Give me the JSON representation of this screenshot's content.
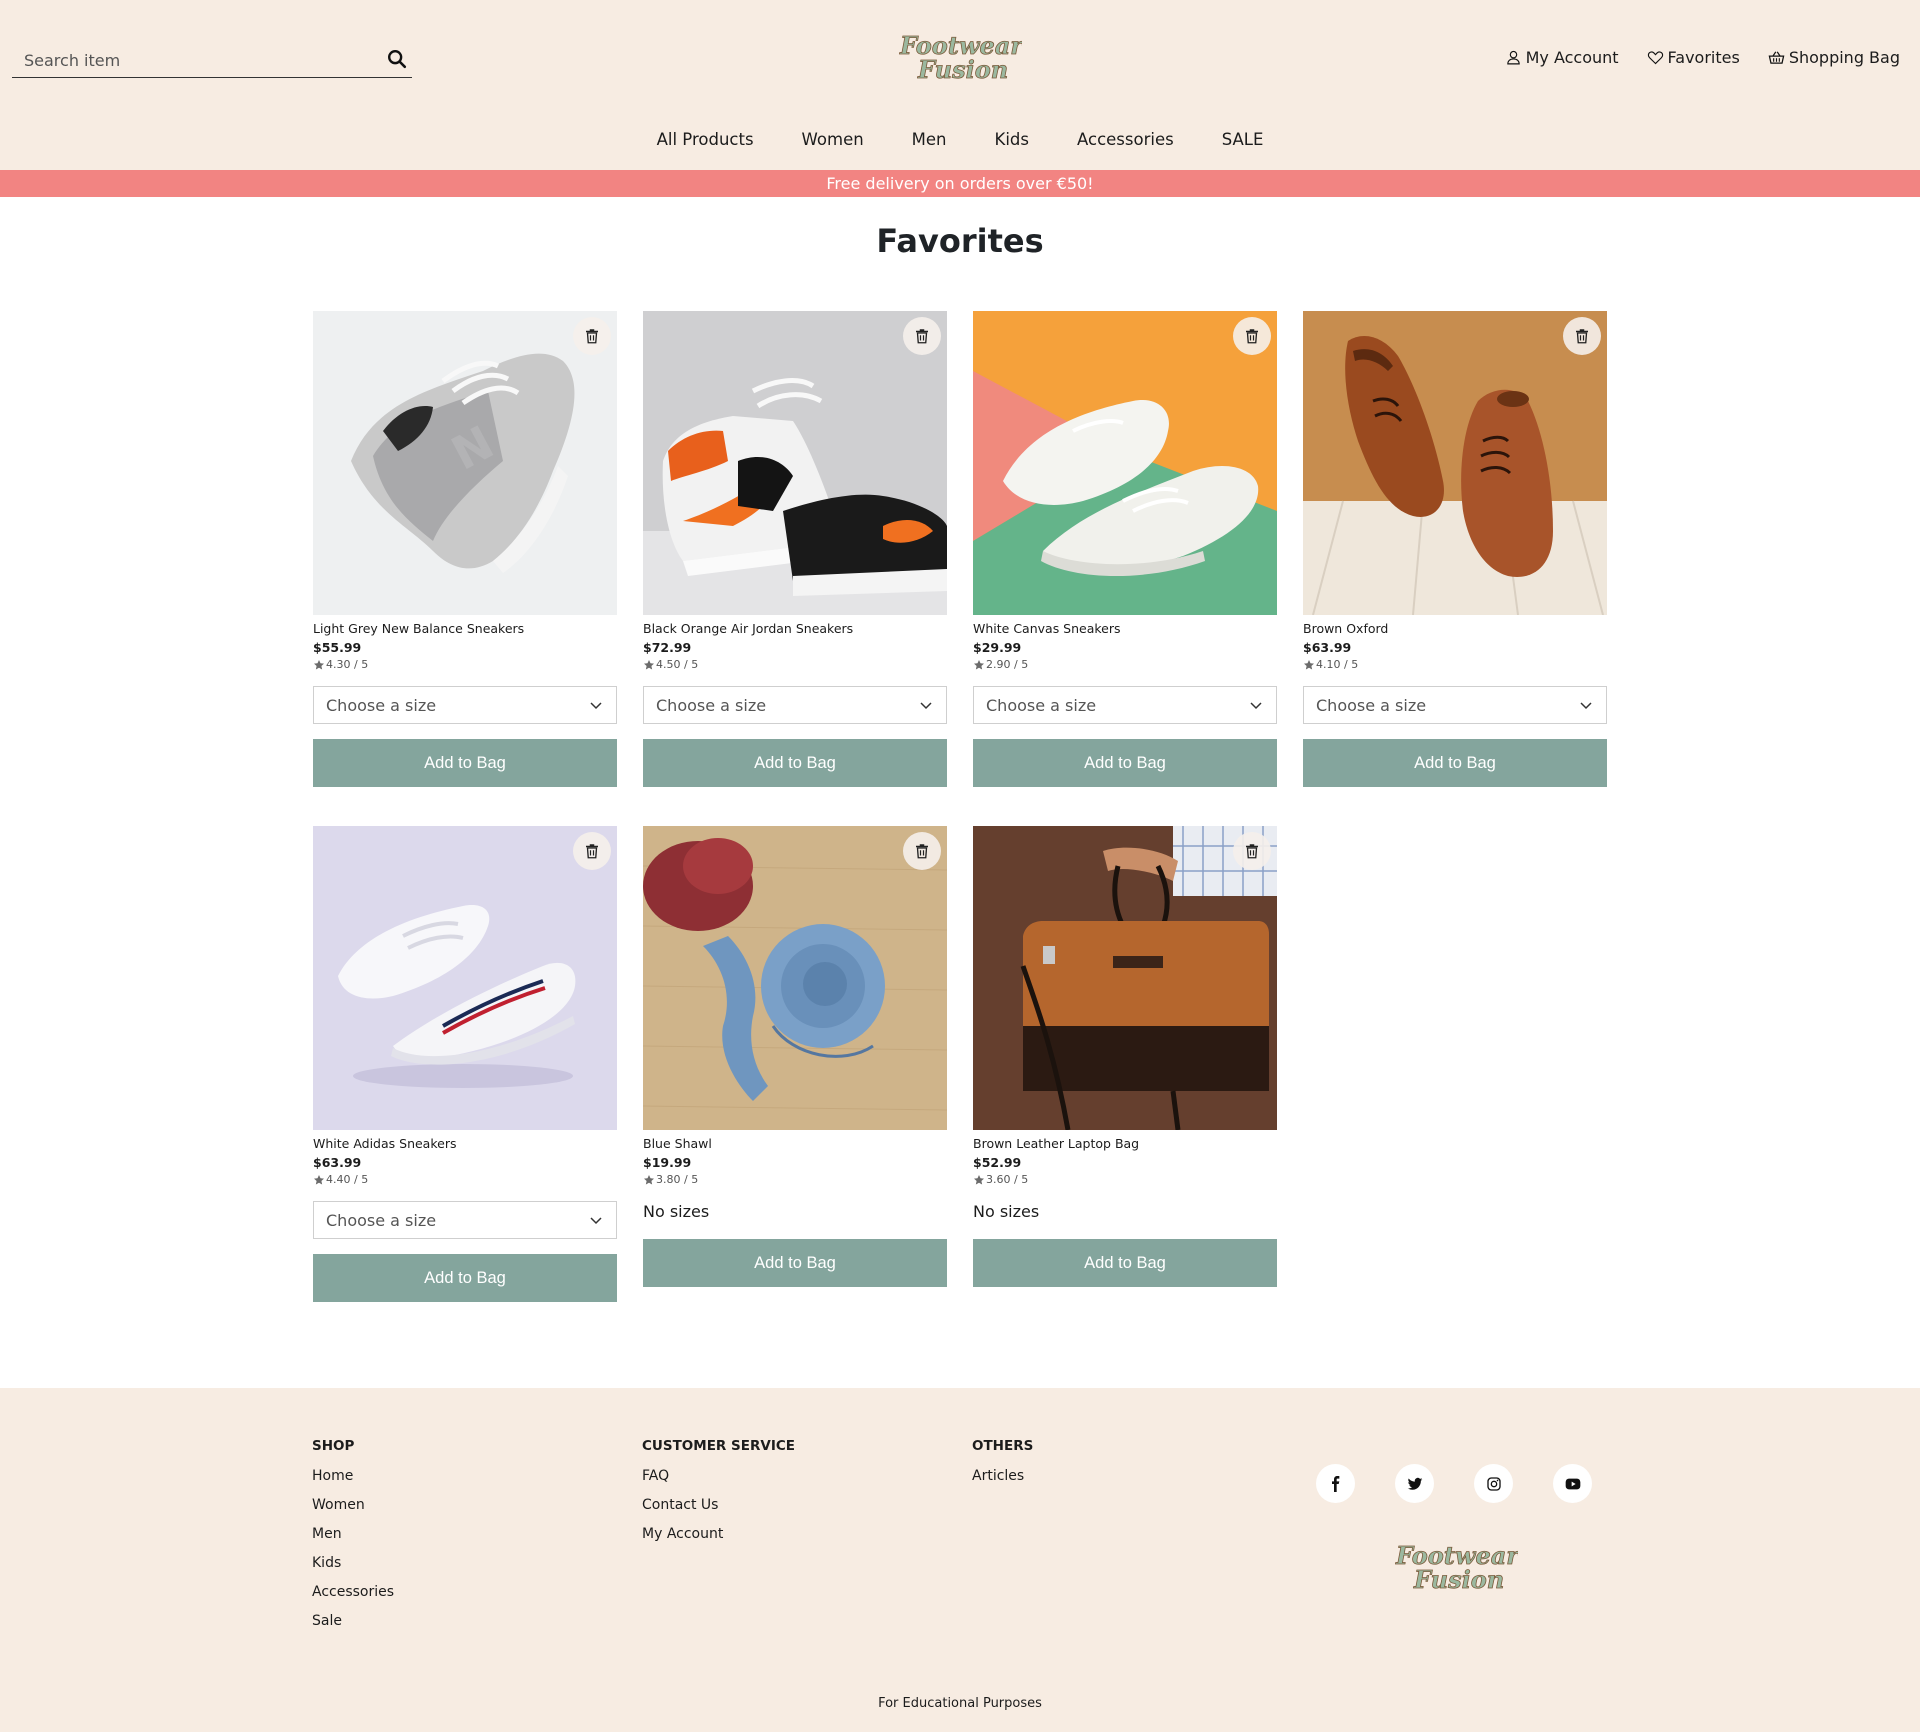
{
  "header": {
    "search_placeholder": "Search item",
    "logo_line1": "Footwear",
    "logo_line2": "Fusion",
    "my_account": "My Account",
    "favorites": "Favorites",
    "shopping_bag": "Shopping Bag"
  },
  "nav": [
    "All Products",
    "Women",
    "Men",
    "Kids",
    "Accessories",
    "SALE"
  ],
  "banner": "Free delivery on orders over €50!",
  "page_title": "Favorites",
  "products": [
    {
      "name": "Light Grey New Balance Sneakers",
      "price": "$55.99",
      "rating": "4.30 / 5",
      "size": "Choose a size",
      "button": "Add to Bag"
    },
    {
      "name": "Black Orange Air Jordan Sneakers",
      "price": "$72.99",
      "rating": "4.50 / 5",
      "size": "Choose a size",
      "button": "Add to Bag"
    },
    {
      "name": "White Canvas Sneakers",
      "price": "$29.99",
      "rating": "2.90 / 5",
      "size": "Choose a size",
      "button": "Add to Bag"
    },
    {
      "name": "Brown Oxford",
      "price": "$63.99",
      "rating": "4.10 / 5",
      "size": "Choose a size",
      "button": "Add to Bag"
    },
    {
      "name": "White Adidas Sneakers",
      "price": "$63.99",
      "rating": "4.40 / 5",
      "size": "Choose a size",
      "button": "Add to Bag"
    },
    {
      "name": "Blue Shawl",
      "price": "$19.99",
      "rating": "3.80 / 5",
      "size": "No sizes",
      "button": "Add to Bag"
    },
    {
      "name": "Brown Leather Laptop Bag",
      "price": "$52.99",
      "rating": "3.60 / 5",
      "size": "No sizes",
      "button": "Add to Bag"
    }
  ],
  "footer": {
    "shop_title": "SHOP",
    "shop_links": [
      "Home",
      "Women",
      "Men",
      "Kids",
      "Accessories",
      "Sale"
    ],
    "service_title": "CUSTOMER SERVICE",
    "service_links": [
      "FAQ",
      "Contact Us",
      "My Account"
    ],
    "others_title": "OTHERS",
    "others_links": [
      "Articles"
    ],
    "socials": [
      "facebook-icon",
      "twitter-icon",
      "instagram-icon",
      "youtube-icon"
    ],
    "copyright": "For Educational Purposes"
  },
  "colors": {
    "header_bg": "#f7ece2",
    "banner_bg": "#f28482",
    "button_bg": "#84a59d"
  }
}
